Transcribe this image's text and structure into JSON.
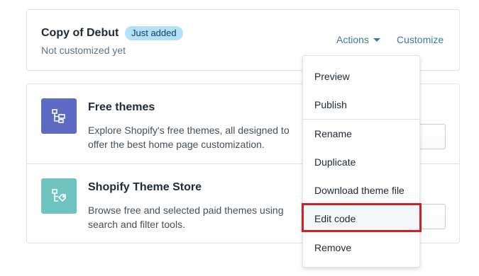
{
  "theme": {
    "name": "Copy of Debut",
    "badge": "Just added",
    "subtitle": "Not customized yet",
    "actions_label": "Actions",
    "customize_label": "Customize"
  },
  "sources": [
    {
      "title": "Free themes",
      "description": "Explore Shopify's free themes, all designed to offer the best home page customization.",
      "button_visible_text": "es",
      "icon": "theme-tree-icon",
      "icon_color": "#5c6ac4"
    },
    {
      "title": "Shopify Theme Store",
      "description": "Browse free and selected paid themes using search and filter tools.",
      "button_visible_text": "",
      "icon": "theme-store-icon",
      "icon_color": "#6fc4c0"
    }
  ],
  "actions_menu": {
    "group1": [
      "Preview",
      "Publish"
    ],
    "group2": [
      "Rename",
      "Duplicate",
      "Download theme file",
      "Edit code",
      "Remove"
    ],
    "highlighted": "Edit code",
    "highlight_color": "#d21f23"
  },
  "colors": {
    "link": "#3f7aa3",
    "badge_bg": "#b4e1fa",
    "border": "#dfe3e8"
  }
}
